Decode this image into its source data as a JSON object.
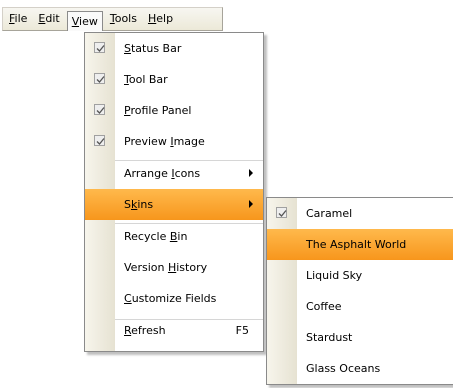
{
  "menubar": {
    "items": [
      {
        "pre": "",
        "key": "F",
        "post": "ile"
      },
      {
        "pre": "",
        "key": "E",
        "post": "dit"
      },
      {
        "pre": "",
        "key": "V",
        "post": "iew"
      },
      {
        "pre": "",
        "key": "T",
        "post": "ools"
      },
      {
        "pre": "",
        "key": "H",
        "post": "elp"
      }
    ]
  },
  "view_menu": {
    "items": [
      {
        "pre": "",
        "key": "S",
        "post": "tatus Bar",
        "checked": true
      },
      {
        "pre": "",
        "key": "T",
        "post": "ool Bar",
        "checked": true
      },
      {
        "pre": "",
        "key": "P",
        "post": "rofile Panel",
        "checked": true
      },
      {
        "pre": "Preview ",
        "key": "I",
        "post": "mage",
        "checked": true
      },
      {
        "pre": "Arrange ",
        "key": "I",
        "post": "cons",
        "submenu": true
      },
      {
        "pre": "S",
        "key": "k",
        "post": "ins",
        "submenu": true,
        "selected": true
      },
      {
        "pre": "Recycle ",
        "key": "B",
        "post": "in"
      },
      {
        "pre": "Version ",
        "key": "H",
        "post": "istory"
      },
      {
        "pre": "",
        "key": "C",
        "post": "ustomize Fields"
      },
      {
        "pre": "",
        "key": "R",
        "post": "efresh",
        "shortcut": "F5"
      }
    ]
  },
  "skins_menu": {
    "items": [
      {
        "label": "Caramel",
        "checked": true
      },
      {
        "label": "The Asphalt World",
        "selected": true
      },
      {
        "label": "Liquid Sky"
      },
      {
        "label": "Coffee"
      },
      {
        "label": "Stardust"
      },
      {
        "label": "Glass Oceans"
      }
    ]
  },
  "colors": {
    "highlight_top": "#ffb94c",
    "highlight_bottom": "#f7961c",
    "menubar": "#ece9d8"
  }
}
